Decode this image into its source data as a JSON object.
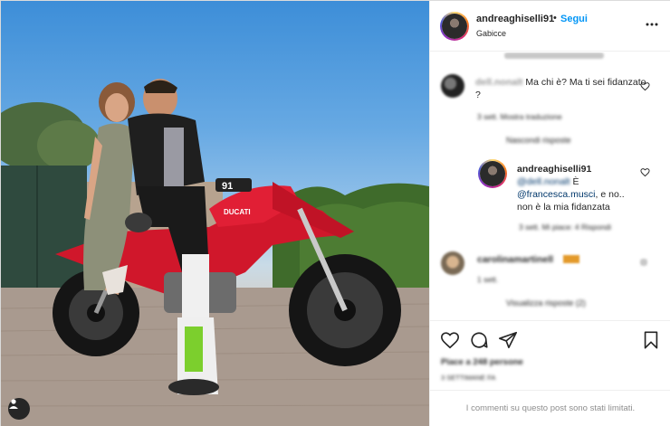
{
  "post": {
    "username": "andreaghiselli91",
    "separator": "•",
    "follow_label": "Segui",
    "location": "Gabicce",
    "bike_number": "91",
    "bike_brand": "DUCATI"
  },
  "comments": [
    {
      "username_blurred": "dell.nonalt",
      "text": "Ma chi è? Ma ti sei fidanzato ?",
      "meta_blurred": "3 sett.   Mostra traduzione"
    },
    {
      "view_replies_blurred": "Nascondi risposte",
      "username": "andreaghiselli91",
      "text_prefix_blurred": "@dell.nonalt",
      "text_prefix_visible": "È",
      "mention": "@francesca.musci",
      "text_suffix": ", e no..",
      "text_line2": "non è la mia fidanzata",
      "meta_blurred": "3 sett.   Mi piace: 4   Rispondi"
    },
    {
      "username_blurred": "carolinamartinell",
      "meta_blurred": "1 sett.",
      "view_replies_blurred": "Visualizza risposte (2)"
    }
  ],
  "likes_blurred": "Piace a 248 persone",
  "date_blurred": "3 SETTIMANE FA",
  "comments_limited_notice": "I commenti su questo post sono stati limitati.",
  "icons": {
    "like": "heart-icon",
    "comment": "comment-icon",
    "share": "paper-plane-icon",
    "save": "bookmark-icon",
    "more": "more-dots-icon",
    "user_tag": "user-tag-icon"
  },
  "colors": {
    "link": "#0095f6",
    "mention": "#00376b",
    "text": "#262626",
    "muted": "#8e8e8e"
  }
}
